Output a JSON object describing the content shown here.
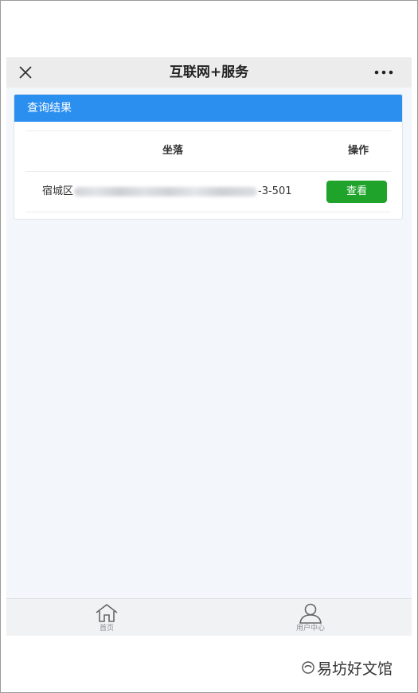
{
  "nav": {
    "title": "互联网+服务"
  },
  "card": {
    "header_title": "查询结果",
    "columns": {
      "location": "坐落",
      "action": "操作"
    },
    "rows": [
      {
        "address_prefix": "宿城区",
        "address_suffix": "-3-501",
        "action_label": "查看"
      }
    ]
  },
  "tabbar": {
    "items": [
      {
        "label": "首页",
        "icon": "home-icon"
      },
      {
        "label": "用户中心",
        "icon": "user-icon"
      }
    ]
  },
  "watermark": {
    "text": "易坊好文馆"
  },
  "colors": {
    "header_blue": "#2b8ff0",
    "button_green": "#1fa32b",
    "page_bg": "#f3f6fa"
  }
}
